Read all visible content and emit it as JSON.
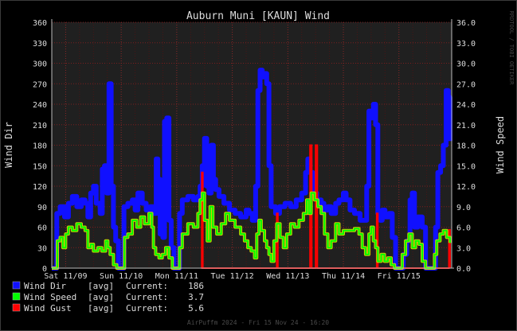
{
  "chart_data": {
    "type": "line",
    "title": "Auburn Muni [KAUN] Wind",
    "ylabel_left": "Wind Dir",
    "ylabel_right": "Wind Speed",
    "ylim_left": [
      0,
      360
    ],
    "ylim_right": [
      0,
      36
    ],
    "yticks_left": [
      0,
      30,
      60,
      90,
      120,
      150,
      180,
      210,
      240,
      270,
      300,
      330,
      360
    ],
    "yticks_right": [
      "0.0",
      "3.0",
      "6.0",
      "9.0",
      "12.0",
      "15.0",
      "18.0",
      "21.0",
      "24.0",
      "27.0",
      "30.0",
      "33.0",
      "36.0"
    ],
    "x_ticks": [
      "Sat 11/09",
      "Sun 11/10",
      "Mon 11/11",
      "Tue 11/12",
      "Wed 11/13",
      "Thu 11/14",
      "Fri 11/15"
    ],
    "x_day_start": [
      0,
      1,
      2,
      3,
      4,
      5,
      6
    ],
    "x_range_days": [
      -0.25,
      6.95
    ],
    "grid": true,
    "watermark": "RRDTOOL / TOBI OETIKER",
    "footer": "AirPuffm 2024 - Fri 15 Nov 24 - 16:20",
    "legend": [
      {
        "name": "Wind Dir",
        "agg": "[avg]",
        "current_label": "Current:",
        "current": "186",
        "color": "#1010ff"
      },
      {
        "name": "Wind Speed",
        "agg": "[avg]",
        "current_label": "Current:",
        "current": "3.7",
        "color": "#00ff00"
      },
      {
        "name": "Wind Gust",
        "agg": "[avg]",
        "current_label": "Current:",
        "current": "5.6",
        "color": "#ff0000"
      }
    ],
    "series": [
      {
        "name": "Wind Dir",
        "axis": "left",
        "color": "#1010ff",
        "points": [
          [
            -0.25,
            0
          ],
          [
            -0.18,
            0
          ],
          [
            -0.16,
            80
          ],
          [
            -0.1,
            90
          ],
          [
            -0.02,
            75
          ],
          [
            0.05,
            95
          ],
          [
            0.12,
            105
          ],
          [
            0.2,
            90
          ],
          [
            0.28,
            100
          ],
          [
            0.35,
            95
          ],
          [
            0.4,
            75
          ],
          [
            0.45,
            110
          ],
          [
            0.5,
            120
          ],
          [
            0.55,
            95
          ],
          [
            0.62,
            80
          ],
          [
            0.66,
            145
          ],
          [
            0.7,
            150
          ],
          [
            0.74,
            110
          ],
          [
            0.78,
            270
          ],
          [
            0.82,
            120
          ],
          [
            0.86,
            60
          ],
          [
            0.9,
            40
          ],
          [
            0.95,
            0
          ],
          [
            1.0,
            0
          ],
          [
            1.05,
            90
          ],
          [
            1.12,
            95
          ],
          [
            1.2,
            100
          ],
          [
            1.25,
            85
          ],
          [
            1.3,
            110
          ],
          [
            1.38,
            95
          ],
          [
            1.45,
            85
          ],
          [
            1.52,
            90
          ],
          [
            1.58,
            80
          ],
          [
            1.63,
            160
          ],
          [
            1.66,
            130
          ],
          [
            1.7,
            50
          ],
          [
            1.75,
            45
          ],
          [
            1.78,
            215
          ],
          [
            1.82,
            220
          ],
          [
            1.86,
            70
          ],
          [
            1.9,
            30
          ],
          [
            1.95,
            0
          ],
          [
            2.0,
            0
          ],
          [
            2.05,
            80
          ],
          [
            2.1,
            100
          ],
          [
            2.2,
            105
          ],
          [
            2.3,
            100
          ],
          [
            2.38,
            105
          ],
          [
            2.42,
            120
          ],
          [
            2.46,
            150
          ],
          [
            2.5,
            190
          ],
          [
            2.54,
            120
          ],
          [
            2.58,
            110
          ],
          [
            2.62,
            180
          ],
          [
            2.66,
            130
          ],
          [
            2.7,
            115
          ],
          [
            2.76,
            105
          ],
          [
            2.85,
            95
          ],
          [
            2.95,
            85
          ],
          [
            3.05,
            80
          ],
          [
            3.15,
            75
          ],
          [
            3.25,
            85
          ],
          [
            3.3,
            80
          ],
          [
            3.36,
            70
          ],
          [
            3.42,
            120
          ],
          [
            3.46,
            260
          ],
          [
            3.5,
            290
          ],
          [
            3.54,
            280
          ],
          [
            3.58,
            285
          ],
          [
            3.62,
            270
          ],
          [
            3.66,
            150
          ],
          [
            3.7,
            90
          ],
          [
            3.78,
            80
          ],
          [
            3.85,
            90
          ],
          [
            3.95,
            95
          ],
          [
            4.05,
            90
          ],
          [
            4.15,
            100
          ],
          [
            4.25,
            110
          ],
          [
            4.32,
            140
          ],
          [
            4.36,
            160
          ],
          [
            4.4,
            140
          ],
          [
            4.45,
            110
          ],
          [
            4.52,
            100
          ],
          [
            4.6,
            95
          ],
          [
            4.65,
            85
          ],
          [
            4.72,
            90
          ],
          [
            4.78,
            80
          ],
          [
            4.86,
            95
          ],
          [
            4.92,
            100
          ],
          [
            5.0,
            110
          ],
          [
            5.05,
            100
          ],
          [
            5.12,
            85
          ],
          [
            5.2,
            80
          ],
          [
            5.3,
            70
          ],
          [
            5.42,
            120
          ],
          [
            5.46,
            230
          ],
          [
            5.5,
            220
          ],
          [
            5.54,
            240
          ],
          [
            5.58,
            210
          ],
          [
            5.62,
            80
          ],
          [
            5.66,
            70
          ],
          [
            5.7,
            85
          ],
          [
            5.75,
            75
          ],
          [
            5.82,
            80
          ],
          [
            5.88,
            45
          ],
          [
            5.94,
            0
          ],
          [
            6.0,
            0
          ],
          [
            6.08,
            20
          ],
          [
            6.14,
            40
          ],
          [
            6.2,
            100
          ],
          [
            6.24,
            110
          ],
          [
            6.28,
            60
          ],
          [
            6.34,
            75
          ],
          [
            6.42,
            60
          ],
          [
            6.48,
            0
          ],
          [
            6.55,
            0
          ],
          [
            6.62,
            0
          ],
          [
            6.66,
            60
          ],
          [
            6.7,
            140
          ],
          [
            6.75,
            150
          ],
          [
            6.8,
            180
          ],
          [
            6.85,
            260
          ],
          [
            6.89,
            250
          ],
          [
            6.92,
            186
          ]
        ]
      },
      {
        "name": "Wind Gust",
        "axis": "right",
        "color": "#ff0000",
        "points": [
          [
            2.44,
            0
          ],
          [
            2.45,
            14
          ],
          [
            2.47,
            0
          ],
          [
            3.79,
            0
          ],
          [
            3.8,
            8
          ],
          [
            3.82,
            0
          ],
          [
            4.38,
            0
          ],
          [
            4.4,
            18
          ],
          [
            4.43,
            0
          ],
          [
            4.48,
            0
          ],
          [
            4.5,
            18
          ],
          [
            4.53,
            0
          ],
          [
            5.58,
            0
          ],
          [
            5.6,
            8
          ],
          [
            5.62,
            0
          ],
          [
            6.88,
            0
          ],
          [
            6.9,
            5.6
          ],
          [
            6.92,
            0
          ]
        ]
      },
      {
        "name": "Wind Speed",
        "axis": "right",
        "color": "#00ff00",
        "points": [
          [
            -0.25,
            0
          ],
          [
            -0.18,
            0
          ],
          [
            -0.15,
            4
          ],
          [
            -0.1,
            4.5
          ],
          [
            -0.05,
            3
          ],
          [
            0.0,
            5
          ],
          [
            0.05,
            6
          ],
          [
            0.12,
            5.5
          ],
          [
            0.2,
            6.5
          ],
          [
            0.28,
            6
          ],
          [
            0.35,
            5.5
          ],
          [
            0.4,
            3
          ],
          [
            0.45,
            3.5
          ],
          [
            0.5,
            2.5
          ],
          [
            0.58,
            3
          ],
          [
            0.65,
            2.5
          ],
          [
            0.72,
            4
          ],
          [
            0.76,
            3
          ],
          [
            0.8,
            2
          ],
          [
            0.86,
            0.5
          ],
          [
            0.92,
            0
          ],
          [
            1.0,
            0
          ],
          [
            1.06,
            4.5
          ],
          [
            1.12,
            5
          ],
          [
            1.2,
            7
          ],
          [
            1.28,
            6
          ],
          [
            1.35,
            7.5
          ],
          [
            1.42,
            6.5
          ],
          [
            1.5,
            8
          ],
          [
            1.55,
            6
          ],
          [
            1.58,
            3
          ],
          [
            1.62,
            2
          ],
          [
            1.68,
            1.5
          ],
          [
            1.74,
            2
          ],
          [
            1.8,
            3
          ],
          [
            1.86,
            1.5
          ],
          [
            1.92,
            0
          ],
          [
            2.0,
            0
          ],
          [
            2.05,
            3
          ],
          [
            2.1,
            5
          ],
          [
            2.2,
            6.5
          ],
          [
            2.3,
            6
          ],
          [
            2.38,
            8
          ],
          [
            2.42,
            10
          ],
          [
            2.46,
            11
          ],
          [
            2.5,
            7
          ],
          [
            2.55,
            4
          ],
          [
            2.6,
            9
          ],
          [
            2.65,
            6
          ],
          [
            2.72,
            5
          ],
          [
            2.8,
            6.5
          ],
          [
            2.88,
            8
          ],
          [
            2.95,
            7
          ],
          [
            3.05,
            6
          ],
          [
            3.15,
            5
          ],
          [
            3.22,
            4
          ],
          [
            3.28,
            3
          ],
          [
            3.34,
            2.5
          ],
          [
            3.4,
            1.5
          ],
          [
            3.44,
            5
          ],
          [
            3.48,
            7
          ],
          [
            3.52,
            5.5
          ],
          [
            3.58,
            4
          ],
          [
            3.62,
            3
          ],
          [
            3.66,
            2
          ],
          [
            3.7,
            1
          ],
          [
            3.75,
            4
          ],
          [
            3.8,
            6.5
          ],
          [
            3.86,
            4.5
          ],
          [
            3.92,
            3
          ],
          [
            3.98,
            5
          ],
          [
            4.05,
            6.5
          ],
          [
            4.12,
            6
          ],
          [
            4.2,
            7
          ],
          [
            4.28,
            8
          ],
          [
            4.34,
            10
          ],
          [
            4.38,
            8
          ],
          [
            4.42,
            11
          ],
          [
            4.48,
            10
          ],
          [
            4.54,
            9
          ],
          [
            4.6,
            8
          ],
          [
            4.66,
            5
          ],
          [
            4.72,
            3
          ],
          [
            4.78,
            4
          ],
          [
            4.86,
            6.5
          ],
          [
            4.92,
            5
          ],
          [
            5.0,
            5.5
          ],
          [
            5.1,
            5.5
          ],
          [
            5.2,
            5.8
          ],
          [
            5.28,
            5
          ],
          [
            5.34,
            3
          ],
          [
            5.4,
            2
          ],
          [
            5.46,
            5
          ],
          [
            5.5,
            6
          ],
          [
            5.54,
            4
          ],
          [
            5.58,
            3
          ],
          [
            5.62,
            1
          ],
          [
            5.68,
            2
          ],
          [
            5.74,
            1
          ],
          [
            5.8,
            1.5
          ],
          [
            5.86,
            0.5
          ],
          [
            5.92,
            0
          ],
          [
            6.0,
            0
          ],
          [
            6.06,
            2
          ],
          [
            6.12,
            4
          ],
          [
            6.18,
            5
          ],
          [
            6.24,
            3
          ],
          [
            6.3,
            4
          ],
          [
            6.36,
            3.5
          ],
          [
            6.42,
            1
          ],
          [
            6.48,
            0
          ],
          [
            6.6,
            0
          ],
          [
            6.64,
            2
          ],
          [
            6.68,
            4
          ],
          [
            6.74,
            5
          ],
          [
            6.8,
            5.5
          ],
          [
            6.86,
            4.5
          ],
          [
            6.92,
            3.7
          ]
        ]
      }
    ]
  }
}
